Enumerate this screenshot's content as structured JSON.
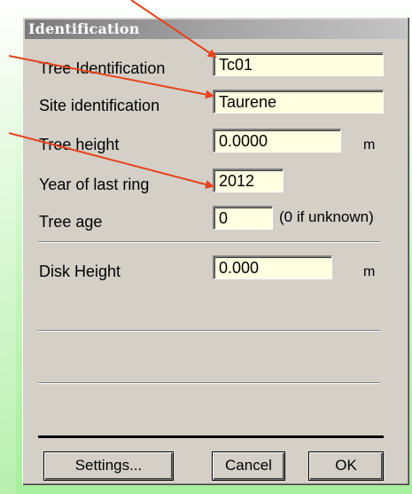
{
  "dialog": {
    "title": "Identification",
    "fields": {
      "tree_id": {
        "label": "Tree Identification",
        "value": "Tc01"
      },
      "site_id": {
        "label": "Site identification",
        "value": "Taurene"
      },
      "tree_height": {
        "label": "Tree height",
        "value": "0.0000",
        "unit": "m"
      },
      "year_last_ring": {
        "label": "Year of last ring",
        "value": "2012"
      },
      "tree_age": {
        "label": "Tree age",
        "value": "0",
        "hint": "(0 if unknown)"
      },
      "disk_height": {
        "label": "Disk Height",
        "value": "0.000",
        "unit": "m"
      }
    },
    "buttons": {
      "settings": "Settings...",
      "cancel": "Cancel",
      "ok": "OK"
    }
  },
  "colors": {
    "field_bg": "#ffffe1",
    "arrow": "#e8431c",
    "dialog_bg": "#d4d0c8"
  }
}
